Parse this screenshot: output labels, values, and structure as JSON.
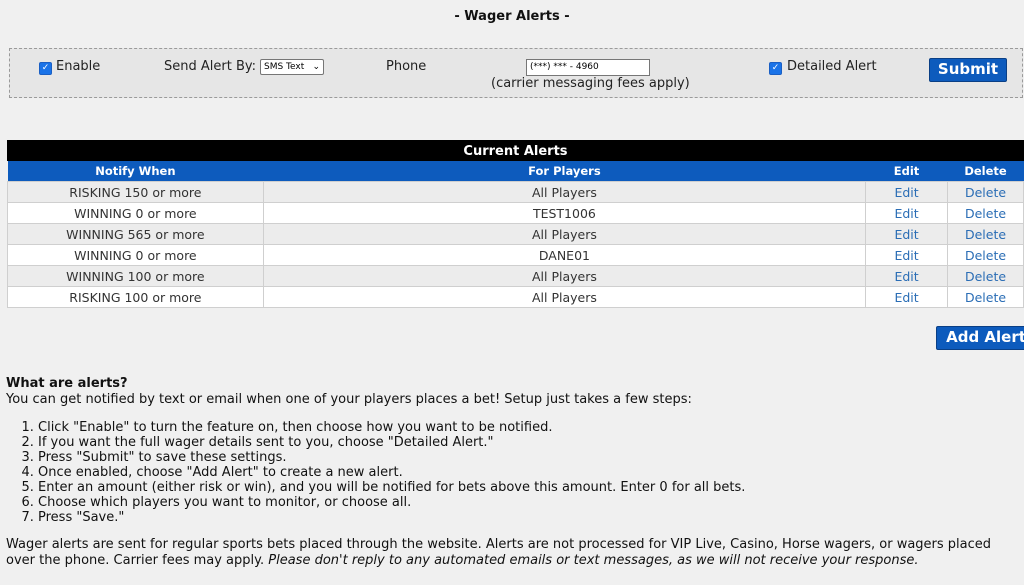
{
  "page": {
    "title": "- Wager Alerts -"
  },
  "settings": {
    "enable_label": "Enable",
    "enable_checked": true,
    "send_by_label": "Send Alert By:",
    "send_by_value": "SMS Text",
    "phone_label": "Phone",
    "phone_value": "(***) *** - 4960",
    "phone_note": "(carrier messaging fees apply)",
    "detailed_label": "Detailed Alert",
    "detailed_checked": true,
    "submit_label": "Submit"
  },
  "alerts": {
    "caption": "Current Alerts",
    "headers": [
      "Notify When",
      "For Players",
      "Edit",
      "Delete"
    ],
    "rows": [
      {
        "notify": "RISKING 150 or more",
        "players": "All Players",
        "edit": "Edit",
        "delete": "Delete"
      },
      {
        "notify": "WINNING 0 or more",
        "players": "TEST1006",
        "edit": "Edit",
        "delete": "Delete"
      },
      {
        "notify": "WINNING 565 or more",
        "players": "All Players",
        "edit": "Edit",
        "delete": "Delete"
      },
      {
        "notify": "WINNING 0 or more",
        "players": "DANE01",
        "edit": "Edit",
        "delete": "Delete"
      },
      {
        "notify": "WINNING 100 or more",
        "players": "All Players",
        "edit": "Edit",
        "delete": "Delete"
      },
      {
        "notify": "RISKING 100 or more",
        "players": "All Players",
        "edit": "Edit",
        "delete": "Delete"
      }
    ],
    "add_label": "Add Alert"
  },
  "info": {
    "heading": "What are alerts?",
    "intro": "You can get notified by text or email when one of your players places a bet! Setup just takes a few steps:",
    "steps": [
      "Click \"Enable\" to turn the feature on, then choose how you want to be notified.",
      "If you want the full wager details sent to you, choose \"Detailed Alert.\"",
      "Press \"Submit\" to save these settings.",
      "Once enabled, choose \"Add Alert\" to create a new alert.",
      "Enter an amount (either risk or win), and you will be notified for bets above this amount. Enter 0 for all bets.",
      "Choose which players you want to monitor, or choose all.",
      "Press \"Save.\""
    ],
    "footer": "Wager alerts are sent for regular sports bets placed through the website. Alerts are not processed for VIP Live, Casino, Horse wagers, or wagers placed over the phone. Carrier fees may apply.",
    "footer_italic": "Please don't reply to any automated emails or text messages, as we will not receive your response."
  }
}
